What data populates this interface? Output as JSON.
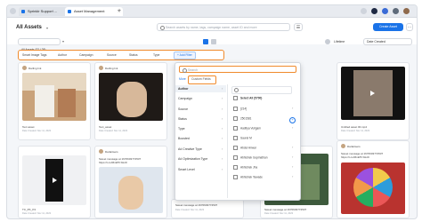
{
  "browser": {
    "tabs": [
      {
        "label": "Sprinklr Support ..."
      },
      {
        "label": "Asset Management"
      }
    ],
    "add_tab": "+"
  },
  "header": {
    "title": "All Assets",
    "search_placeholder": "Search assets by name, tags, campaign name, asset ID and more",
    "create_button": "Create Asset",
    "more": "⋯"
  },
  "toolbar": {
    "assets_select": "All Assets (32 | 28)",
    "lifetime": "Lifetime",
    "date_created": "Date Created"
  },
  "filters": {
    "chips": [
      "Smart Image Tags",
      "Author",
      "Campaign",
      "Source",
      "Status",
      "Type"
    ],
    "add_filter": "+ Add Filter"
  },
  "filter_panel": {
    "search_placeholder": "Search",
    "tabs": [
      "More",
      "Custom Fields"
    ],
    "left_items": [
      "Author",
      "Campaign",
      "Source",
      "Status",
      "Type",
      "Boosted",
      "Ad Creative Type",
      "Ad Optimization Type",
      "Smart Level"
    ],
    "select_all": "Select All (5700)",
    "options": [
      "[214]",
      "2501581",
      "Aaditya Vuligam",
      "Saurel M",
      "Abdul Anwar",
      "Abhishek Gopinathan",
      "Abhishek Jha",
      "Abhishek Tawade"
    ]
  },
  "cards": [
    {
      "user": "Darling Ink",
      "caption": "Text asset",
      "date": "Date Created: Nov 11, 2023"
    },
    {
      "user": "Darling Ink",
      "caption": "Text_asset",
      "date": "Date Created: Nov 11, 2023"
    },
    {
      "user": "",
      "caption": "Untitled asset 1876",
      "date": "Date Created: Nov 11, 2023"
    },
    {
      "user": "",
      "caption": "Untitled asset 00.mp4",
      "date": "Date Created: Nov 11, 2023"
    },
    {
      "user": "",
      "caption": "TC_PK_P4",
      "date": "Date Created: Nov 11, 2023"
    },
    {
      "user": "Darlartsers",
      "caption": "Sweet message at 1670603774537\nhttps://t.co/MnE5YJHxD",
      "date": "Date Created: Nov 11, 2023"
    },
    {
      "user": "",
      "caption": "Sweet message at 1670603774537",
      "date": "Date Created: Nov 11, 2023"
    },
    {
      "user": "",
      "caption": "Sweet message at 1670603774537",
      "date": "Date Created: Nov 11, 2023"
    },
    {
      "user": "Darlartsers",
      "caption": "Sweet message at 1670603774537\nhttps://t.co/MnE5YJHxD",
      "date": "Date Created: Nov 11, 2023"
    }
  ],
  "colors": {
    "accent": "#1a73e8",
    "highlight": "#f08a2b"
  }
}
